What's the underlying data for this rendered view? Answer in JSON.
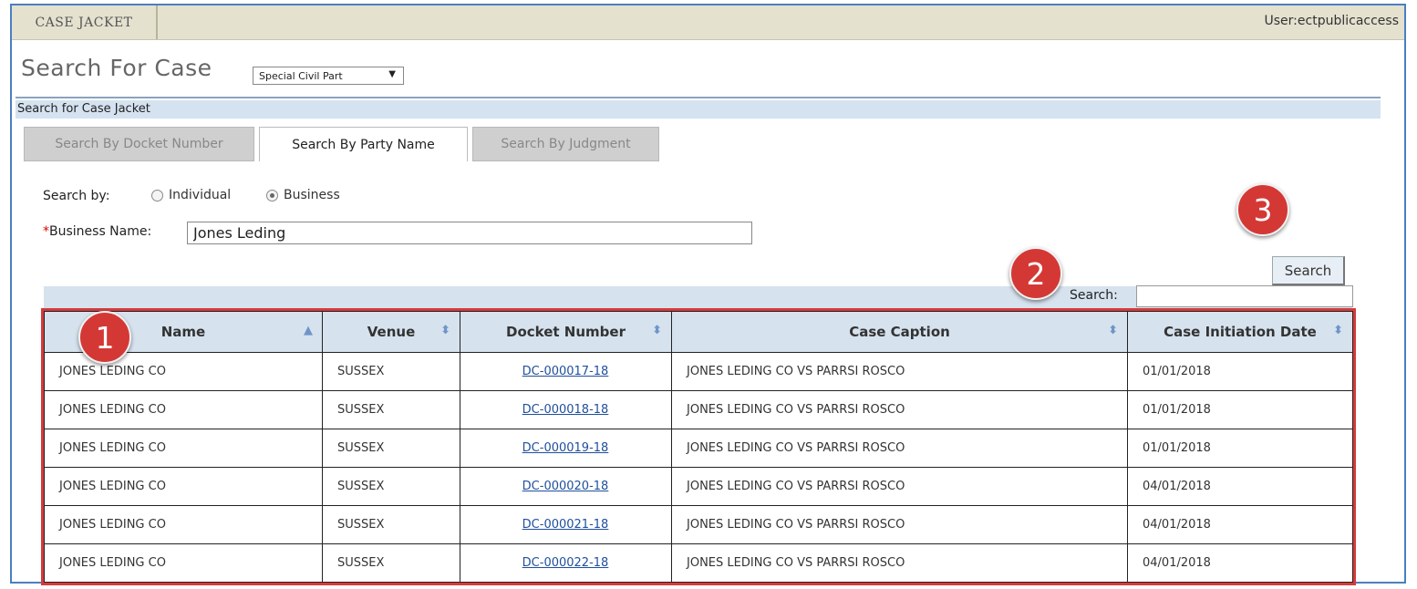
{
  "header": {
    "app_tab": "CASE JACKET",
    "user_label": "User:ectpublicaccess"
  },
  "page": {
    "title": "Search For Case",
    "case_type_selected": "Special Civil Part",
    "section_label": "Search for Case Jacket"
  },
  "tabs": [
    {
      "label": "Search By Docket Number",
      "active": false
    },
    {
      "label": "Search By Party Name",
      "active": true
    },
    {
      "label": "Search By Judgment",
      "active": false
    }
  ],
  "search_by": {
    "label": "Search by:",
    "options": [
      {
        "label": "Individual",
        "checked": false
      },
      {
        "label": "Business",
        "checked": true
      }
    ]
  },
  "business_name": {
    "required_mark": "*",
    "label": "Business Name:",
    "value": "Jones Leding"
  },
  "search_button_label": "Search",
  "table_filter_label": "Search:",
  "table": {
    "columns": [
      "Name",
      "Venue",
      "Docket Number",
      "Case Caption",
      "Case Initiation Date"
    ],
    "rows": [
      [
        "JONES LEDING CO",
        "SUSSEX",
        "DC-000017-18",
        "JONES LEDING CO VS PARRSI ROSCO",
        "01/01/2018"
      ],
      [
        "JONES LEDING CO",
        "SUSSEX",
        "DC-000018-18",
        "JONES LEDING CO VS PARRSI ROSCO",
        "01/01/2018"
      ],
      [
        "JONES LEDING CO",
        "SUSSEX",
        "DC-000019-18",
        "JONES LEDING CO VS PARRSI ROSCO",
        "01/01/2018"
      ],
      [
        "JONES LEDING CO",
        "SUSSEX",
        "DC-000020-18",
        "JONES LEDING CO VS PARRSI ROSCO",
        "04/01/2018"
      ],
      [
        "JONES LEDING CO",
        "SUSSEX",
        "DC-000021-18",
        "JONES LEDING CO VS PARRSI ROSCO",
        "04/01/2018"
      ],
      [
        "JONES LEDING CO",
        "SUSSEX",
        "DC-000022-18",
        "JONES LEDING CO VS PARRSI ROSCO",
        "04/01/2018"
      ]
    ]
  },
  "icons": {
    "sort_asc": "sort-ascending-icon",
    "sort_both": "sort-both-icon",
    "dropdown": "dropdown-arrow-icon"
  },
  "callouts": [
    "1",
    "2",
    "3"
  ],
  "colors": {
    "callout": "#d43835",
    "highlight_border": "#d63a3a",
    "link": "#1f4f9c",
    "header_bar": "#e4e1cf"
  }
}
